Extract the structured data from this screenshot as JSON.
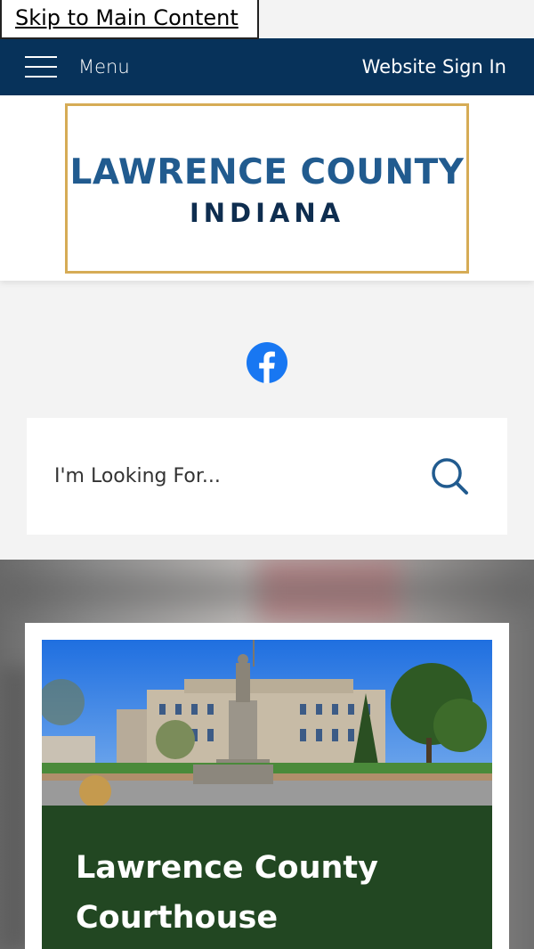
{
  "skip_link": "Skip to Main Content",
  "header": {
    "menu_label": "Menu",
    "signin_label": "Website Sign In",
    "bg_color": "#07325a"
  },
  "logo": {
    "line1": "LAWRENCE COUNTY",
    "line2": "INDIANA",
    "border_color": "#d6ac56"
  },
  "social": {
    "icon": "facebook-icon",
    "color": "#1877f2"
  },
  "search": {
    "placeholder": "I'm Looking For...",
    "icon": "search-icon"
  },
  "feature": {
    "title": "Lawrence County Courthouse",
    "caption_bg": "#224722"
  }
}
